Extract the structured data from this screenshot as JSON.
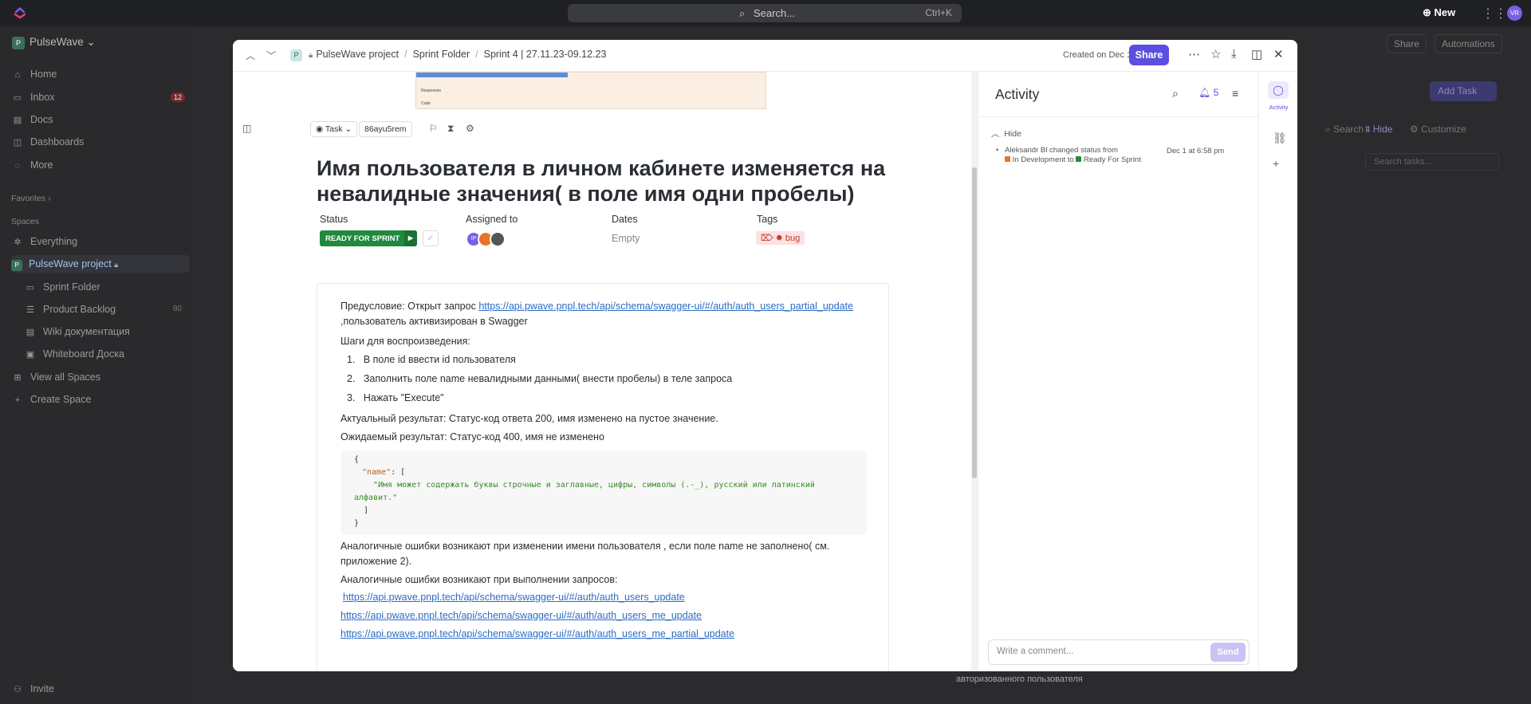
{
  "topbar": {
    "search_label": "Search...",
    "search_shortcut": "Ctrl+K",
    "new_label": "New",
    "user_initials": "VR"
  },
  "sidebar": {
    "workspace": "PulseWave",
    "workspace_initial": "P",
    "items": [
      {
        "icon": "home-icon",
        "label": "Home"
      },
      {
        "icon": "inbox-icon",
        "label": "Inbox",
        "badge": "12"
      },
      {
        "icon": "docs-icon",
        "label": "Docs"
      },
      {
        "icon": "dashboards-icon",
        "label": "Dashboards"
      },
      {
        "icon": "more-icon",
        "label": "More"
      }
    ],
    "favorites_label": "Favorites",
    "spaces_label": "Spaces",
    "spaces": [
      {
        "label": "Everything"
      },
      {
        "label": "PulseWave project",
        "selected": true
      },
      {
        "label": "Sprint Folder"
      },
      {
        "label": "Product Backlog",
        "count": "80"
      },
      {
        "label": "Wiki документация"
      },
      {
        "label": "Whiteboard Доска"
      },
      {
        "label": "View all Spaces"
      },
      {
        "label": "Create Space"
      }
    ],
    "invite_label": "Invite"
  },
  "background": {
    "share_label": "Share",
    "automations_label": "Automations",
    "add_task_label": "Add Task",
    "search_label": "Search",
    "hide_label": "Hide",
    "customize_label": "Customize",
    "search_tasks_placeholder": "Search tasks...",
    "bottom_text": "авторизованного пользователя"
  },
  "modal": {
    "breadcrumb": {
      "space_initial": "P",
      "project": "PulseWave project",
      "folder": "Sprint Folder",
      "sprint": "Sprint 4 | 27.11.23-09.12.23"
    },
    "created": "Created on Dec 1",
    "share_label": "Share",
    "task_type": "Task",
    "task_id": "86ayu5rem",
    "image_strip": {
      "row1": "Responses",
      "row2": "Code"
    },
    "title": "Имя пользователя в личном кабинете изменяется на невалидные значения( в поле имя одни пробелы)",
    "fields": {
      "status_label": "Status",
      "status_value": "READY FOR SPRINT",
      "assigned_label": "Assigned to",
      "assignee_initials": "IP",
      "dates_label": "Dates",
      "dates_value": "Empty",
      "tags_label": "Tags",
      "tag_value": "bug"
    },
    "description": {
      "precondition_prefix": "Предусловие: Открыт запрос ",
      "precondition_link": "https://api.pwave.pnpl.tech/api/schema/swagger-ui/#/auth/auth_users_partial_update",
      "precondition_suffix": " ,пользователь активизирован в Swagger",
      "steps_heading": "Шаги для воспроизведения:",
      "steps": [
        "В поле id ввести  id пользователя",
        "Заполнить поле name невалидными данными( внести пробелы) в теле запроса",
        "Нажать \"Execute\""
      ],
      "actual": "Актуальный результат: Статус-код  ответа 200, имя изменено на пустое значение.",
      "expected": "Ожидаемый результат: Статус-код 400, имя  не изменено",
      "code": {
        "open": "{",
        "key": "\"name\"",
        "after_key": ": [",
        "message_line1": "\"Имя может содержать буквы строчные и заглавные, цифры, символы (.-_), русский или латинский",
        "message_line2": "алфавит.\"",
        "close_bracket": "]",
        "close": "}"
      },
      "similar1": " Аналогичные ошибки возникают при изменении имени пользователя , если поле name не заполнено( см. приложение 2).",
      "similar2": "Аналогичные ошибки возникают при выполнении запросов:",
      "links": [
        "https://api.pwave.pnpl.tech/api/schema/swagger-ui/#/auth/auth_users_update",
        "https://api.pwave.pnpl.tech/api/schema/swagger-ui/#/auth/auth_users_me_update",
        "https://api.pwave.pnpl.tech/api/schema/swagger-ui/#/auth/auth_users_me_partial_update"
      ]
    }
  },
  "activity": {
    "title": "Activity",
    "notif_count": "5",
    "hide_label": "Hide",
    "entry": {
      "actor": "Aleksandr Bl",
      "action": "changed status from",
      "from_status": "In Development",
      "to_word": "to",
      "to_status": "Ready For Sprint",
      "date": "Dec 1 at 6:58 pm"
    },
    "comment_placeholder": "Write a comment...",
    "send_label": "Send",
    "rail_label": "Activity"
  },
  "colors": {
    "accent": "#5b4fe0",
    "status_green": "#1f8a3e",
    "in_development": "#e8732a",
    "tag_bg": "#fde2e2",
    "link": "#2b6cc4"
  }
}
